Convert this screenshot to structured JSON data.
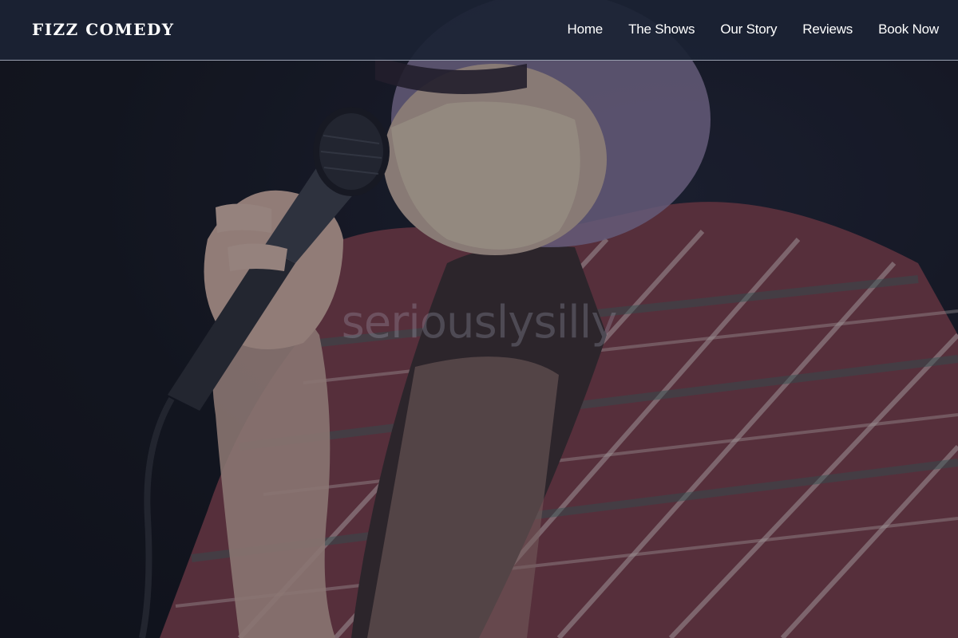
{
  "brand": {
    "name": "FIZZ COMEDY"
  },
  "nav": {
    "items": [
      {
        "label": "Home"
      },
      {
        "label": "The Shows"
      },
      {
        "label": "Our Story"
      },
      {
        "label": "Reviews"
      },
      {
        "label": "Book Now"
      }
    ]
  },
  "hero": {
    "tagline": "seriouslysilly",
    "image": "comedian-with-microphone"
  },
  "colors": {
    "navbar_background": "#1b2234",
    "text": "#ffffff",
    "hero_background": "#12151d"
  }
}
